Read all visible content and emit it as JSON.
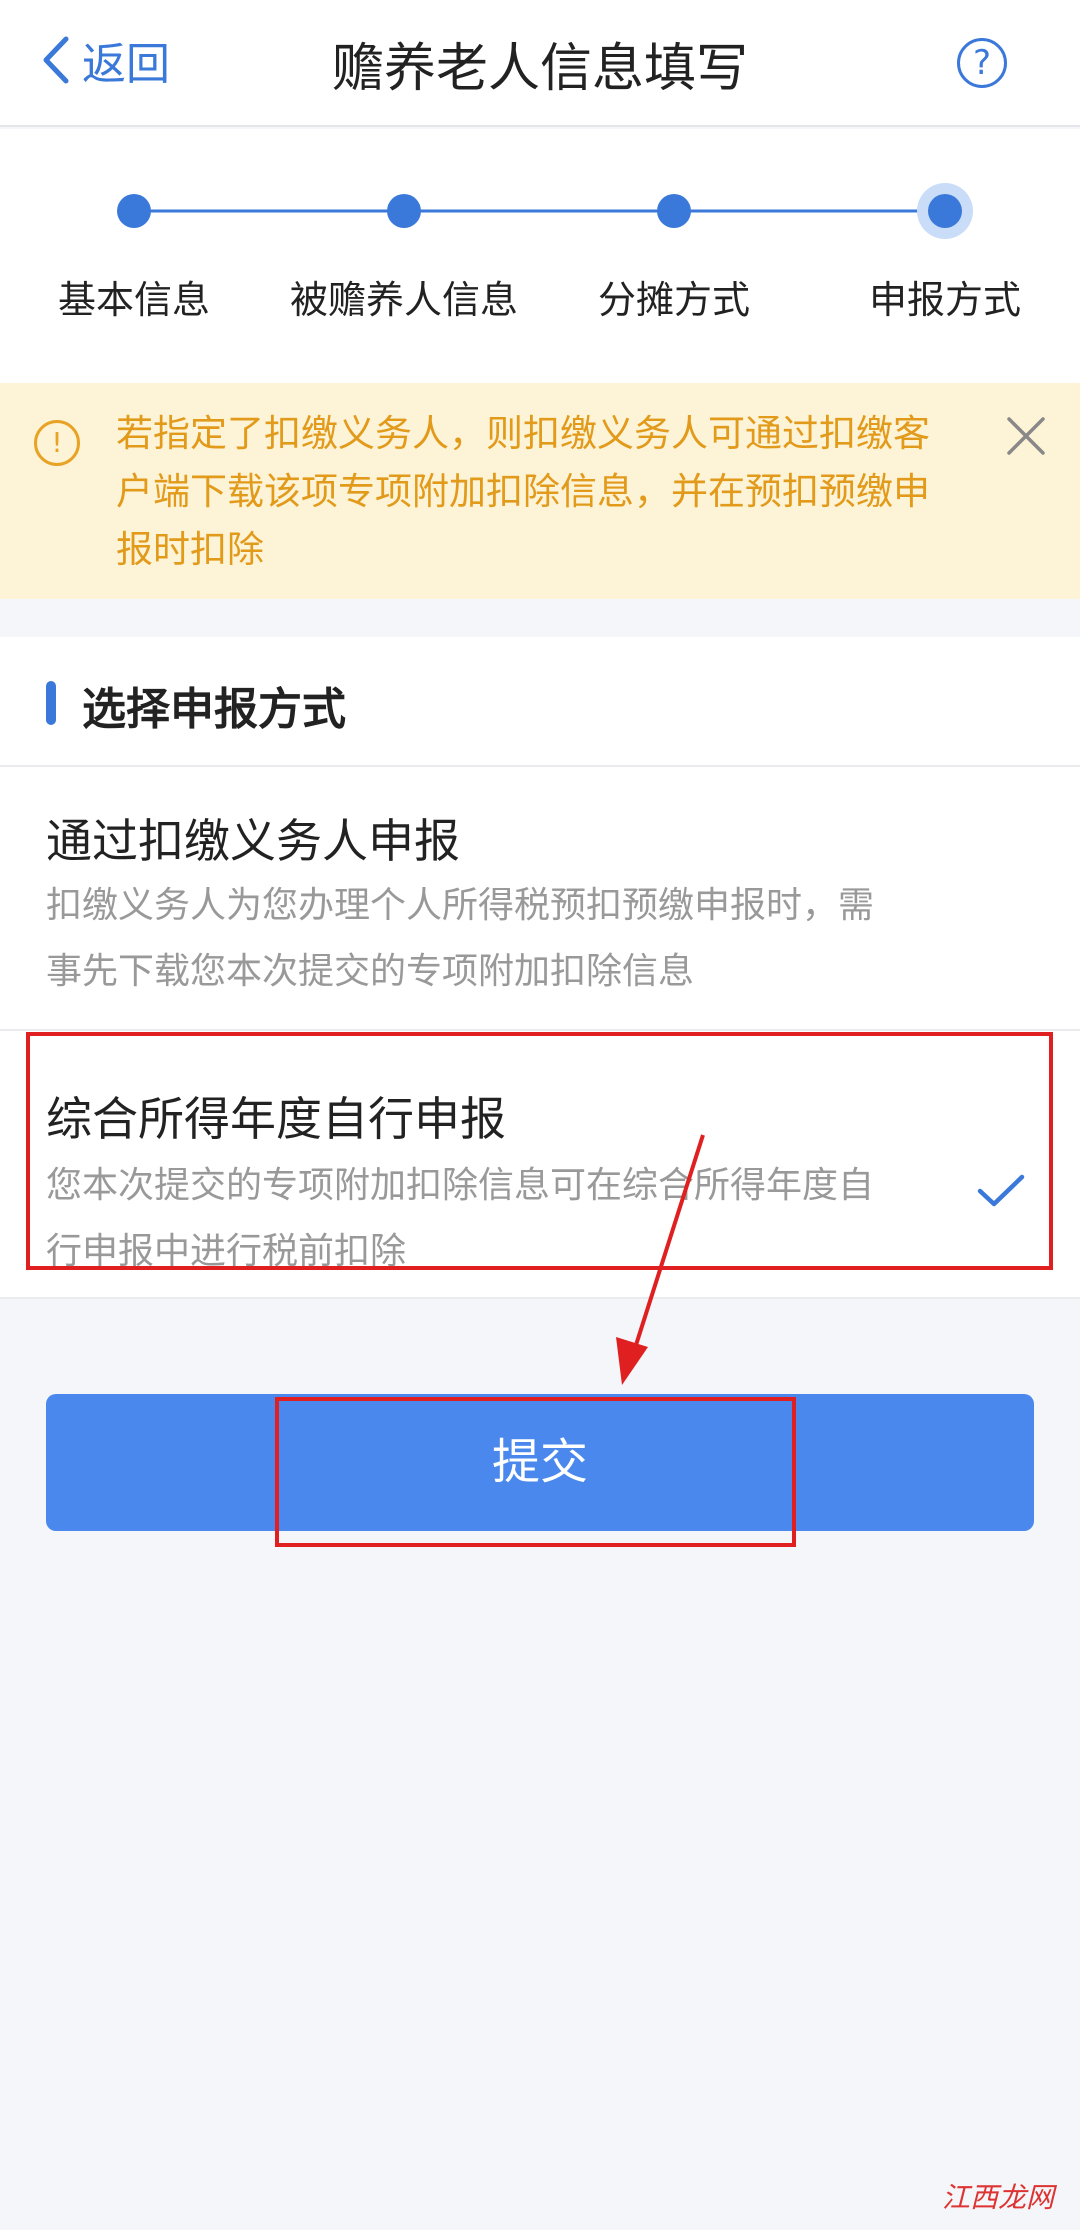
{
  "navbar": {
    "back_label": "返回",
    "title": "赡养老人信息填写",
    "help_symbol": "?"
  },
  "steps": [
    {
      "label": "基本信息",
      "state": "done"
    },
    {
      "label": "被赡养人信息",
      "state": "done"
    },
    {
      "label": "分摊方式",
      "state": "done"
    },
    {
      "label": "申报方式",
      "state": "current"
    }
  ],
  "notice": {
    "icon": "!",
    "text": "若指定了扣缴义务人，则扣缴义务人可通过扣缴客户端下载该项专项附加扣除信息，并在预扣预缴申报时扣除"
  },
  "section": {
    "title": "选择申报方式",
    "options": [
      {
        "title": "通过扣缴义务人申报",
        "desc": "扣缴义务人为您办理个人所得税预扣预缴申报时，需事先下载您本次提交的专项附加扣除信息",
        "selected": false
      },
      {
        "title": "综合所得年度自行申报",
        "desc": "您本次提交的专项附加扣除信息可在综合所得年度自行申报中进行税前扣除",
        "selected": true
      }
    ]
  },
  "submit_label": "提交",
  "watermark": "江西龙网",
  "colors": {
    "accent": "#3a79d9",
    "button": "#4a88ee",
    "notice_bg": "#fdf3d6",
    "notice_text": "#e29a1b",
    "annotation": "#e02020"
  }
}
